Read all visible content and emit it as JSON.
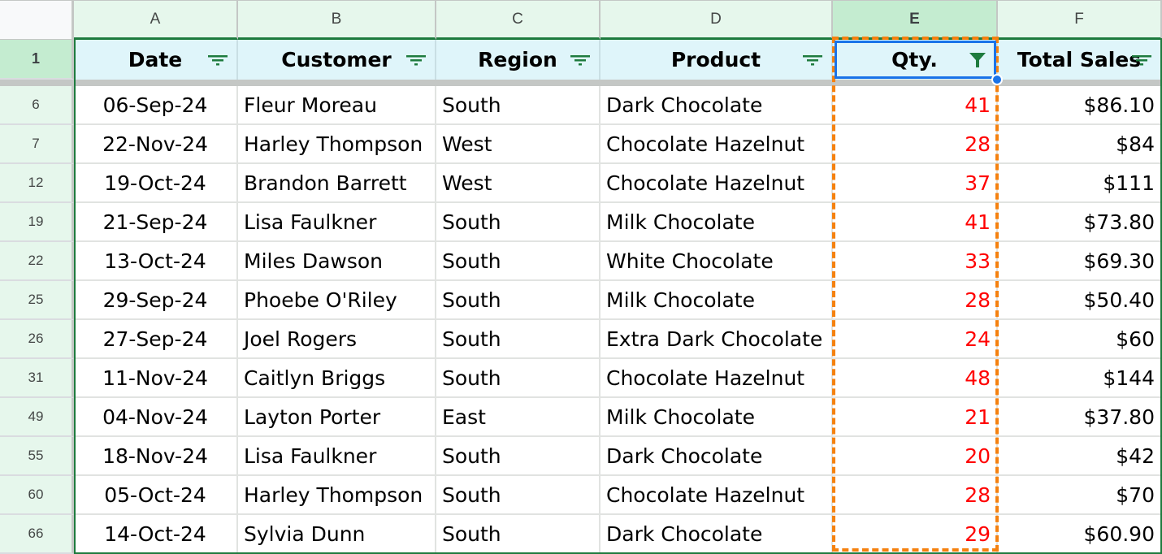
{
  "columns": [
    "A",
    "B",
    "C",
    "D",
    "E",
    "F"
  ],
  "selected_column": "E",
  "header_row_number": "1",
  "headers": [
    {
      "label": "Date",
      "filter": "filter-list-icon"
    },
    {
      "label": "Customer",
      "filter": "filter-list-icon"
    },
    {
      "label": "Region",
      "filter": "filter-list-icon"
    },
    {
      "label": "Product",
      "filter": "filter-list-icon"
    },
    {
      "label": "Qty.",
      "filter": "filter-active-funnel-icon"
    },
    {
      "label": "Total Sales",
      "filter": "filter-list-icon"
    }
  ],
  "rows": [
    {
      "num": "6",
      "cells": [
        "06-Sep-24",
        "Fleur Moreau",
        "South",
        "Dark Chocolate",
        "41",
        "$86.10"
      ]
    },
    {
      "num": "7",
      "cells": [
        "22-Nov-24",
        "Harley Thompson",
        "West",
        "Chocolate Hazelnut",
        "28",
        "$84"
      ]
    },
    {
      "num": "12",
      "cells": [
        "19-Oct-24",
        "Brandon Barrett",
        "West",
        "Chocolate Hazelnut",
        "37",
        "$111"
      ]
    },
    {
      "num": "19",
      "cells": [
        "21-Sep-24",
        "Lisa Faulkner",
        "South",
        "Milk Chocolate",
        "41",
        "$73.80"
      ]
    },
    {
      "num": "22",
      "cells": [
        "13-Oct-24",
        "Miles Dawson",
        "South",
        "White Chocolate",
        "33",
        "$69.30"
      ]
    },
    {
      "num": "25",
      "cells": [
        "29-Sep-24",
        "Phoebe O'Riley",
        "South",
        "Milk Chocolate",
        "28",
        "$50.40"
      ]
    },
    {
      "num": "26",
      "cells": [
        "27-Sep-24",
        "Joel Rogers",
        "South",
        "Extra Dark Chocolate",
        "24",
        "$60"
      ]
    },
    {
      "num": "31",
      "cells": [
        "11-Nov-24",
        "Caitlyn Briggs",
        "South",
        "Chocolate Hazelnut",
        "48",
        "$144"
      ]
    },
    {
      "num": "49",
      "cells": [
        "04-Nov-24",
        "Layton Porter",
        "East",
        "Milk Chocolate",
        "21",
        "$37.80"
      ]
    },
    {
      "num": "55",
      "cells": [
        "18-Nov-24",
        "Lisa Faulkner",
        "South",
        "Dark Chocolate",
        "20",
        "$42"
      ]
    },
    {
      "num": "60",
      "cells": [
        "05-Oct-24",
        "Harley Thompson",
        "South",
        "Chocolate Hazelnut",
        "28",
        "$70"
      ]
    },
    {
      "num": "66",
      "cells": [
        "14-Oct-24",
        "Sylvia Dunn",
        "South",
        "Dark Chocolate",
        "29",
        "$60.90"
      ]
    }
  ],
  "colors": {
    "filter_green": "#1e7b3e",
    "qty_text": "#ff0000",
    "highlight_dash": "#f5810f",
    "selection_blue": "#1a73e8"
  }
}
